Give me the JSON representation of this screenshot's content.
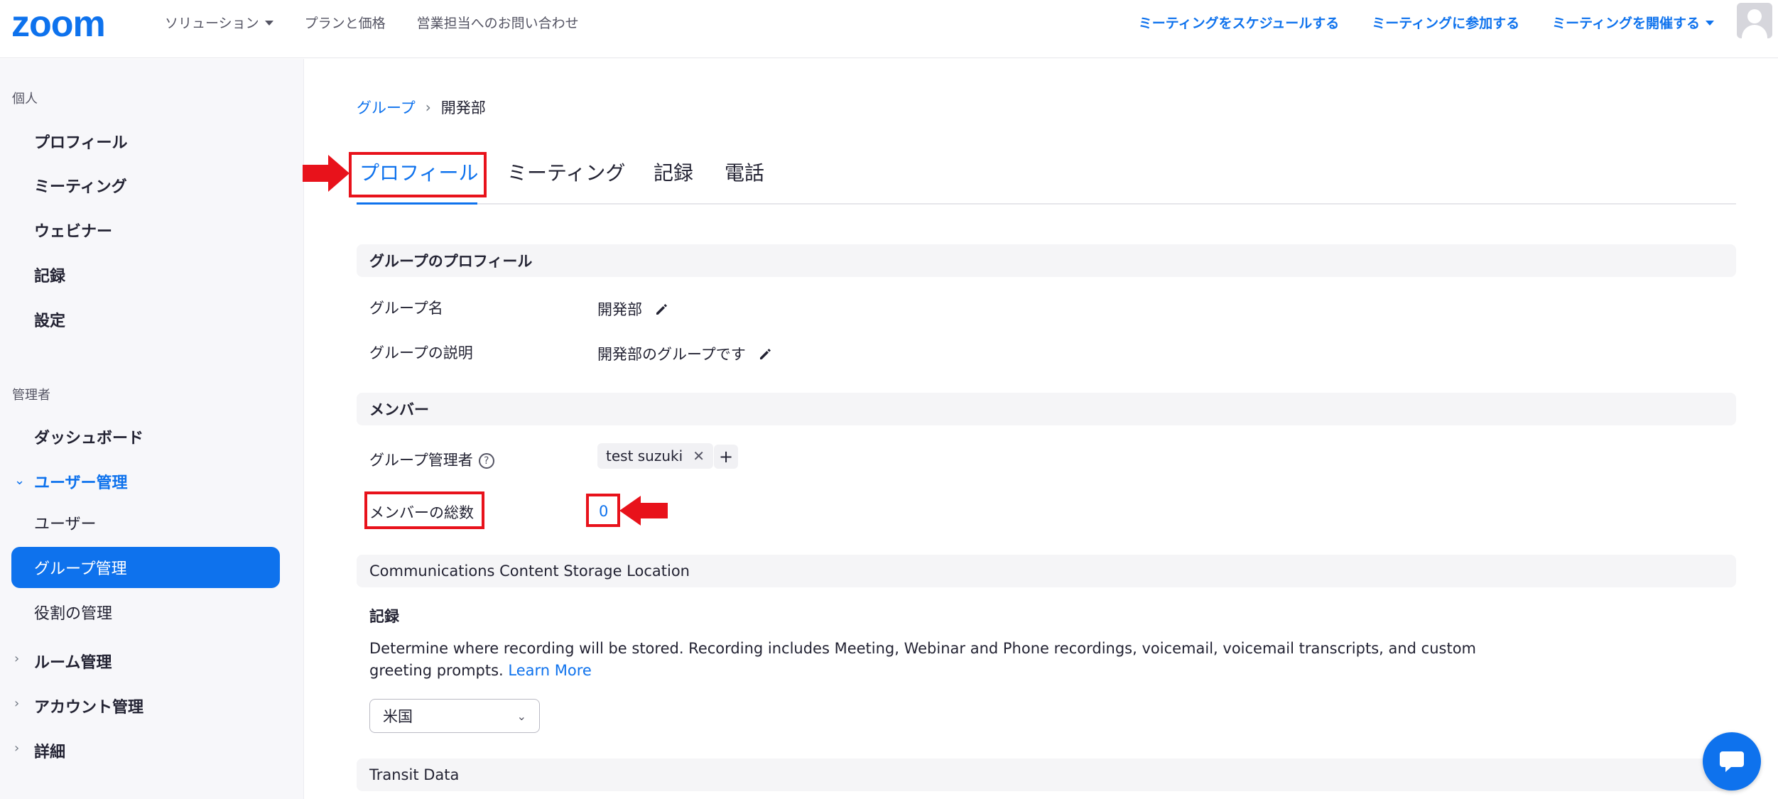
{
  "brand": {
    "logo_text": "zoom",
    "accent": "#0e72ed"
  },
  "topnav": {
    "left": [
      "ソリューション",
      "プランと価格",
      "営業担当へのお問い合わせ"
    ],
    "right": [
      "ミーティングをスケジュールする",
      "ミーティングに参加する",
      "ミーティングを開催する"
    ]
  },
  "sidebar": {
    "personal_label": "個人",
    "personal_items": [
      "プロフィール",
      "ミーティング",
      "ウェビナー",
      "記録",
      "設定"
    ],
    "admin_label": "管理者",
    "dashboard": "ダッシュボード",
    "user_mgmt": "ユーザー管理",
    "user_mgmt_children": [
      "ユーザー",
      "グループ管理",
      "役割の管理"
    ],
    "room_mgmt": "ルーム管理",
    "account_mgmt": "アカウント管理",
    "advanced": "詳細"
  },
  "breadcrumb": {
    "parent": "グループ",
    "current": "開発部"
  },
  "tabs": [
    "プロフィール",
    "ミーティング",
    "記録",
    "電話"
  ],
  "profile": {
    "header": "グループのプロフィール",
    "name_label": "グループ名",
    "name_value": "開発部",
    "desc_label": "グループの説明",
    "desc_value": "開発部のグループです"
  },
  "members": {
    "header": "メンバー",
    "admin_label": "グループ管理者",
    "admin_chip": "test suzuki",
    "total_label": "メンバーの総数",
    "total_value": "0"
  },
  "storage": {
    "header": "Communications Content Storage Location",
    "sub_title": "記録",
    "description": "Determine where recording will be stored. Recording includes Meeting, Webinar and Phone recordings, voicemail, voicemail transcripts, and custom greeting prompts.",
    "learn_more": "Learn More",
    "region_value": "米国"
  },
  "transit": {
    "header": "Transit Data"
  },
  "annotation_color": "#e8121b"
}
